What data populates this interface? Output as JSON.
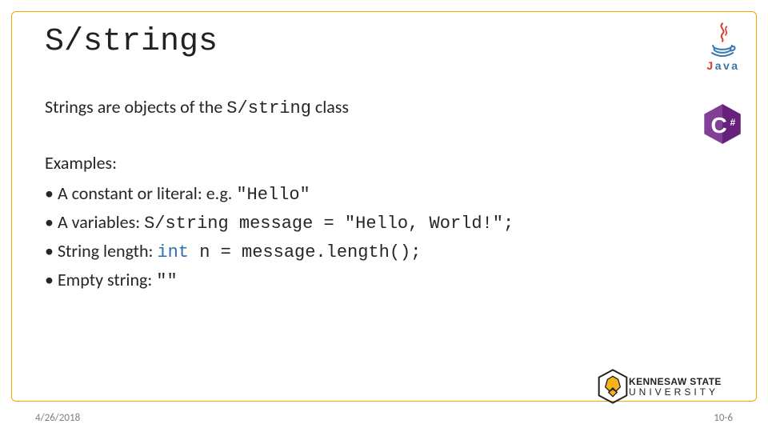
{
  "title": "S/strings",
  "intro_prefix": "Strings are objects of the ",
  "intro_code": "S/string",
  "intro_suffix": " class",
  "examples_heading": "Examples:",
  "bullets": [
    {
      "label": "A constant or literal: e.g. ",
      "code": "\"Hello\""
    },
    {
      "label": "A variables: ",
      "code": "S/string message = \"Hello, World!\";"
    },
    {
      "label": "String length: ",
      "code_colored": [
        {
          "t": "int",
          "c": "#2f6fab"
        },
        {
          "t": " n = message.length();",
          "c": "#262626"
        }
      ]
    },
    {
      "label": "Empty string: ",
      "code": "\"\""
    }
  ],
  "footer_date": "4/26/2018",
  "footer_page": "10-6",
  "java_label": "Java",
  "ksu_top": "KENNESAW STATE",
  "ksu_bot": "UNIVERSITY",
  "colors": {
    "border": "#f2a900",
    "java_red": "#d63a2b",
    "java_blue": "#3776ab",
    "csharp_purple": "#68217a",
    "ksu_gold": "#f4b41a"
  }
}
